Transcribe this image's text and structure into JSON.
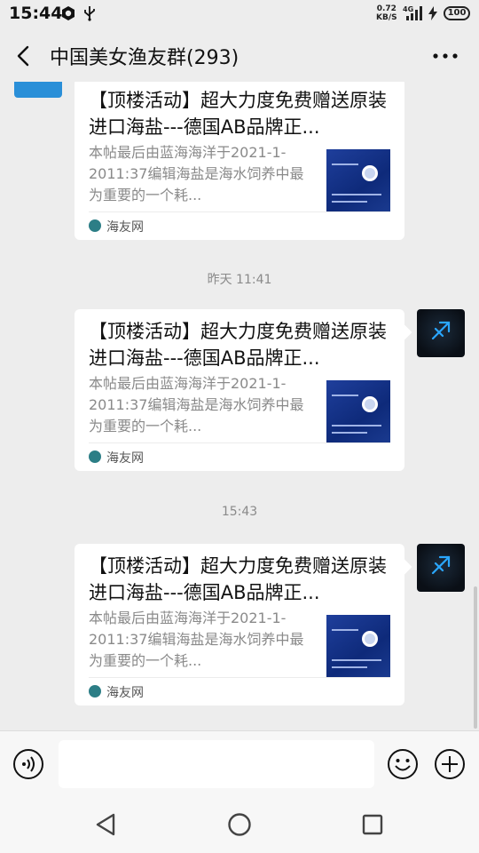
{
  "status_bar": {
    "time": "15:44",
    "net_speed_value": "0.72",
    "net_speed_unit": "KB/S",
    "network": "4G",
    "battery": "100"
  },
  "header": {
    "title": "中国美女渔友群(293)"
  },
  "messages": [
    {
      "timestamp": "",
      "title": "【顶楼活动】超大力度免费赠送原装进口海盐---德国AB品牌正...",
      "desc": "本帖最后由蓝海海洋于2021-1-2011:37编辑海盐是海水饲养中最为重要的一个耗...",
      "source": "海友网"
    },
    {
      "timestamp": "昨天 11:41",
      "title": "【顶楼活动】超大力度免费赠送原装进口海盐---德国AB品牌正...",
      "desc": "本帖最后由蓝海海洋于2021-1-2011:37编辑海盐是海水饲养中最为重要的一个耗...",
      "source": "海友网"
    },
    {
      "timestamp": "15:43",
      "title": "【顶楼活动】超大力度免费赠送原装进口海盐---德国AB品牌正...",
      "desc": "本帖最后由蓝海海洋于2021-1-2011:37编辑海盐是海水饲养中最为重要的一个耗...",
      "source": "海友网"
    }
  ],
  "input_bar": {
    "value": "",
    "placeholder": ""
  },
  "colors": {
    "background": "#ededed",
    "card": "#ffffff",
    "source_icon": "#2c7e86"
  },
  "icons": {
    "back": "chevron-left-icon",
    "more": "more-dots-icon",
    "voice": "voice-icon",
    "emoji": "emoji-icon",
    "plus": "plus-icon",
    "nav_back": "triangle-back-icon",
    "nav_home": "circle-home-icon",
    "nav_recent": "square-recent-icon"
  }
}
